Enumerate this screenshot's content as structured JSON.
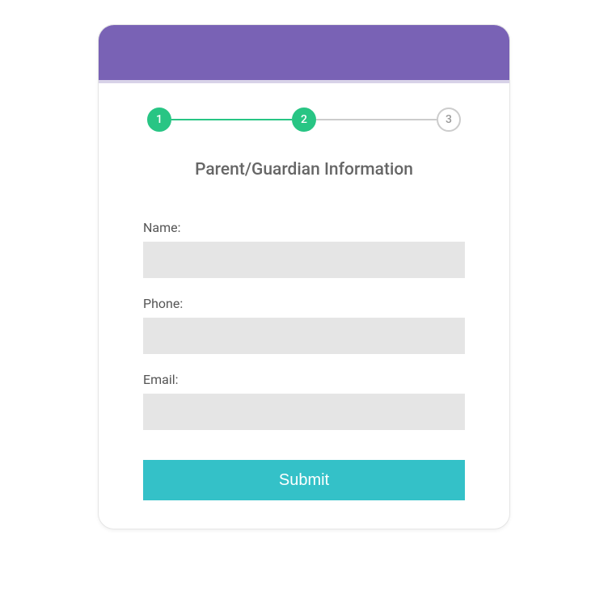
{
  "stepper": {
    "steps": [
      {
        "label": "1",
        "active": true
      },
      {
        "label": "2",
        "active": true
      },
      {
        "label": "3",
        "active": false
      }
    ]
  },
  "form": {
    "title": "Parent/Guardian Information",
    "fields": {
      "name": {
        "label": "Name:",
        "value": ""
      },
      "phone": {
        "label": "Phone:",
        "value": ""
      },
      "email": {
        "label": "Email:",
        "value": ""
      }
    },
    "submit_label": "Submit"
  }
}
